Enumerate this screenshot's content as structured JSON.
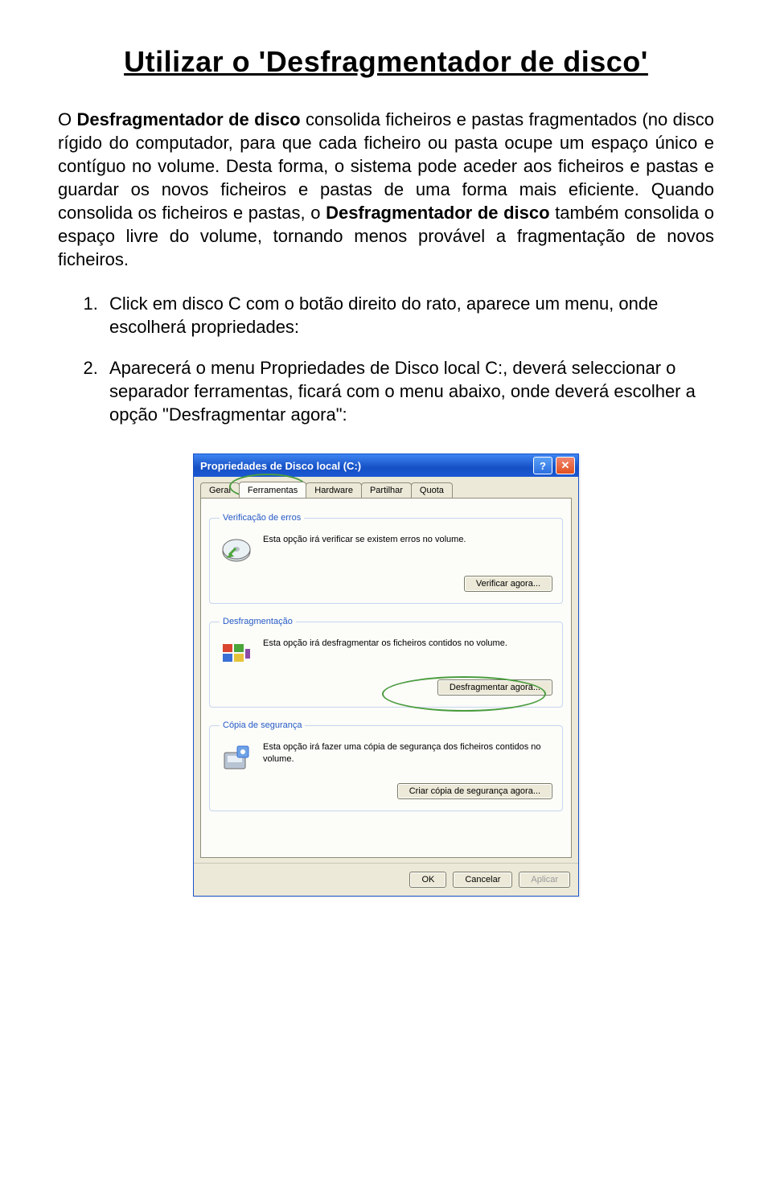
{
  "title": "Utilizar o 'Desfragmentador de disco'",
  "paragraph_parts": {
    "p1_a": "O ",
    "p1_b": "Desfragmentador de disco",
    "p1_c": " consolida ficheiros e pastas fragmentados (no disco rígido do computador, para que cada ficheiro ou pasta ocupe um espaço único e contíguo no volume. Desta forma, o sistema pode aceder aos ficheiros e pastas e guardar os novos ficheiros e pastas de uma forma mais eficiente. Quando consolida os ficheiros e pastas, o ",
    "p1_d": "Desfragmentador de disco",
    "p1_e": " também consolida o espaço livre do volume, tornando menos provável a fragmentação de novos ficheiros."
  },
  "steps": {
    "s1": "Click em disco C com o botão direito do rato, aparece um menu, onde escolherá propriedades:",
    "s2": "Aparecerá o menu Propriedades de Disco local C:, deverá seleccionar o separador ferramentas, ficará com o menu abaixo, onde deverá escolher a opção \"Desfragmentar agora\":"
  },
  "dialog": {
    "title": "Propriedades de Disco local (C:)",
    "help_label": "?",
    "close_label": "✕",
    "tabs": {
      "geral": "Geral",
      "ferramentas": "Ferramentas",
      "hardware": "Hardware",
      "partilhar": "Partilhar",
      "quota": "Quota"
    },
    "groups": {
      "verify": {
        "legend": "Verificação de erros",
        "text": "Esta opção irá verificar se existem erros no volume.",
        "button": "Verificar agora..."
      },
      "defrag": {
        "legend": "Desfragmentação",
        "text": "Esta opção irá desfragmentar os ficheiros contidos no volume.",
        "button": "Desfragmentar agora..."
      },
      "backup": {
        "legend": "Cópia de segurança",
        "text": "Esta opção irá fazer uma cópia de segurança dos ficheiros contidos no volume.",
        "button": "Criar cópia de segurança agora..."
      }
    },
    "footer": {
      "ok": "OK",
      "cancel": "Cancelar",
      "apply": "Aplicar"
    }
  }
}
